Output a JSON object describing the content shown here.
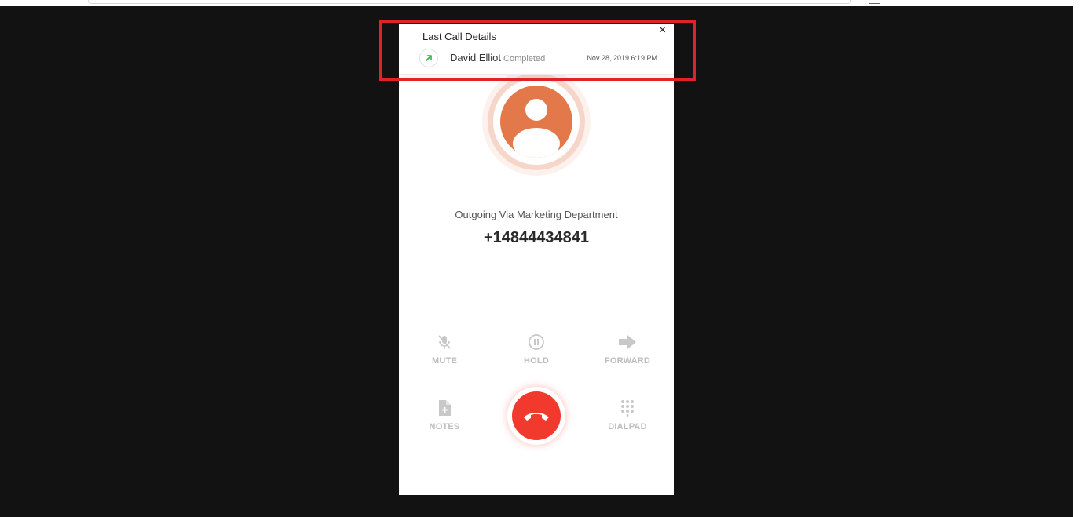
{
  "last_call": {
    "title": "Last Call Details",
    "close_glyph": "×",
    "contact_name": "David Elliot",
    "status": "Completed",
    "datetime": "Nov 28, 2019 6:19 PM",
    "direction_icon": "outgoing-arrow-icon"
  },
  "call": {
    "via_text": "Outgoing Via Marketing Department",
    "phone_number": "+14844434841"
  },
  "controls": {
    "mute": "MUTE",
    "hold": "HOLD",
    "forward": "FORWARD",
    "notes": "NOTES",
    "dialpad": "DIALPAD"
  },
  "colors": {
    "avatar": "#e3784a",
    "end_call": "#f2392d",
    "highlight": "#e0232a",
    "outgoing_arrow": "#2bb34a"
  }
}
